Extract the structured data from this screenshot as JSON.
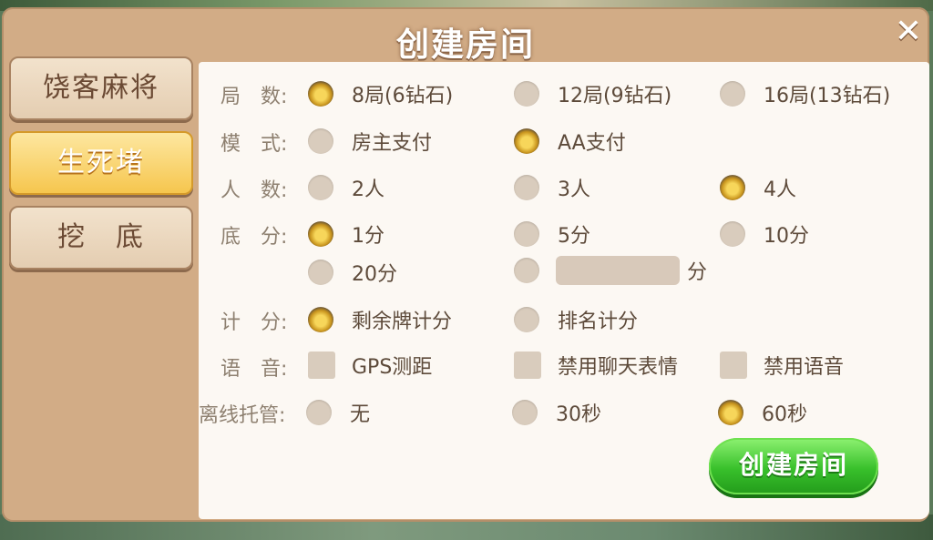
{
  "dialog": {
    "title": "创建房间",
    "close_label": "✕"
  },
  "tabs": [
    {
      "label": "饶客麻将",
      "active": false
    },
    {
      "label": "生死堵",
      "active": true
    },
    {
      "label": "挖　底",
      "active": false
    }
  ],
  "rows": {
    "rounds": {
      "label": "局　数:",
      "options": [
        {
          "label": "8局(6钻石)",
          "selected": true
        },
        {
          "label": "12局(9钻石)",
          "selected": false
        },
        {
          "label": "16局(13钻石)",
          "selected": false
        }
      ]
    },
    "mode": {
      "label": "模　式:",
      "options": [
        {
          "label": "房主支付",
          "selected": false
        },
        {
          "label": "AA支付",
          "selected": true
        }
      ]
    },
    "players": {
      "label": "人　数:",
      "options": [
        {
          "label": "2人",
          "selected": false
        },
        {
          "label": "3人",
          "selected": false
        },
        {
          "label": "4人",
          "selected": true
        }
      ]
    },
    "base": {
      "label": "底　分:",
      "options": [
        {
          "label": "1分",
          "selected": true
        },
        {
          "label": "5分",
          "selected": false
        },
        {
          "label": "10分",
          "selected": false
        },
        {
          "label": "20分",
          "selected": false
        }
      ],
      "custom_unit": "分",
      "custom_value": ""
    },
    "scoring": {
      "label": "计　分:",
      "options": [
        {
          "label": "剩余牌计分",
          "selected": true
        },
        {
          "label": "排名计分",
          "selected": false
        }
      ]
    },
    "voice": {
      "label": "语　音:",
      "options": [
        {
          "label": "GPS测距",
          "checked": false
        },
        {
          "label": "禁用聊天表情",
          "checked": false
        },
        {
          "label": "禁用语音",
          "checked": false
        }
      ]
    },
    "offline": {
      "label": "离线托管:",
      "options": [
        {
          "label": "无",
          "selected": false
        },
        {
          "label": "30秒",
          "selected": false
        },
        {
          "label": "60秒",
          "selected": true
        }
      ]
    }
  },
  "create_button": "创建房间"
}
